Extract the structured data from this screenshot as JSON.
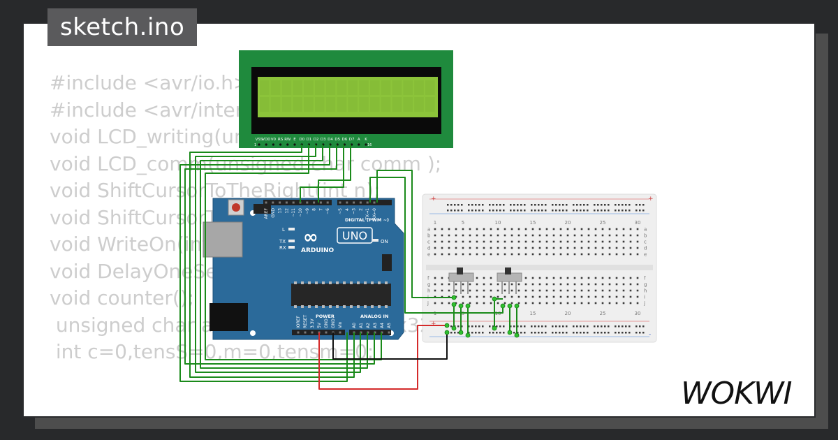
{
  "project": {
    "filename": "sketch.ino",
    "brand": "WOKWI"
  },
  "code_lines": [
    "#include <avr/io.h>",
    "#include <avr/interrupt.h>",
    "void LCD_writing(unsigned char data);",
    "void LCD_comm(unsigned char comm );",
    "void ShiftCursorToTheRight(int n);",
    "void ShiftCursorToTheLeft(int n);",
    "void WriteOn(int pos, unsigned char",
    "void DelayOneSecond();",
    "void counter();",
    " unsigned char arr[]={0x30,0x31,0x32,0x33,0x34,0x35",
    " int c=0,tensS=0,m=0,tensm=0;"
  ],
  "lcd": {
    "pin_labels": [
      "VSS",
      "VDD",
      "V0",
      "RS",
      "RW",
      "E",
      "D0",
      "D1",
      "D2",
      "D3",
      "D4",
      "D5",
      "D6",
      "D7",
      "A",
      "K"
    ],
    "pin_first": "1",
    "pin_last": "16",
    "colors": {
      "pcb": "#1f8a3d",
      "bezel": "#0a0a0a",
      "screen": "#8cc43a"
    }
  },
  "arduino": {
    "model": "UNO",
    "brand": "ARDUINO",
    "digital_header": "DIGITAL (PWM ~)",
    "digital_pins": [
      "AREF",
      "GND",
      "13",
      "12",
      "~11",
      "~10",
      "~9",
      "8",
      "7",
      "~6",
      "~5",
      "4",
      "~3",
      "2",
      "TX→1",
      "RX←0"
    ],
    "power_header": "POWER",
    "power_pins": [
      "IOREF",
      "RESET",
      "3.3V",
      "5V",
      "GND",
      "GND",
      "Vin"
    ],
    "analog_header": "ANALOG IN",
    "analog_pins": [
      "A0",
      "A1",
      "A2",
      "A3",
      "A4",
      "A5"
    ],
    "leds": {
      "l": "L",
      "tx": "TX",
      "rx": "RX",
      "on": "ON"
    },
    "colors": {
      "board": "#2b6a9a",
      "chip": "#262626",
      "reset": "#c0392b"
    }
  },
  "breadboard": {
    "column_numbers": [
      "1",
      "5",
      "10",
      "15",
      "20",
      "25",
      "30"
    ],
    "row_letters_top": [
      "a",
      "b",
      "c",
      "d",
      "e"
    ],
    "row_letters_bottom": [
      "f",
      "g",
      "h",
      "i",
      "j"
    ],
    "rail_plus": "+",
    "rail_minus": "-"
  },
  "wire_colors": {
    "signal": "#1a8a1a",
    "power": "#d42a2a",
    "ground": "#111111"
  }
}
